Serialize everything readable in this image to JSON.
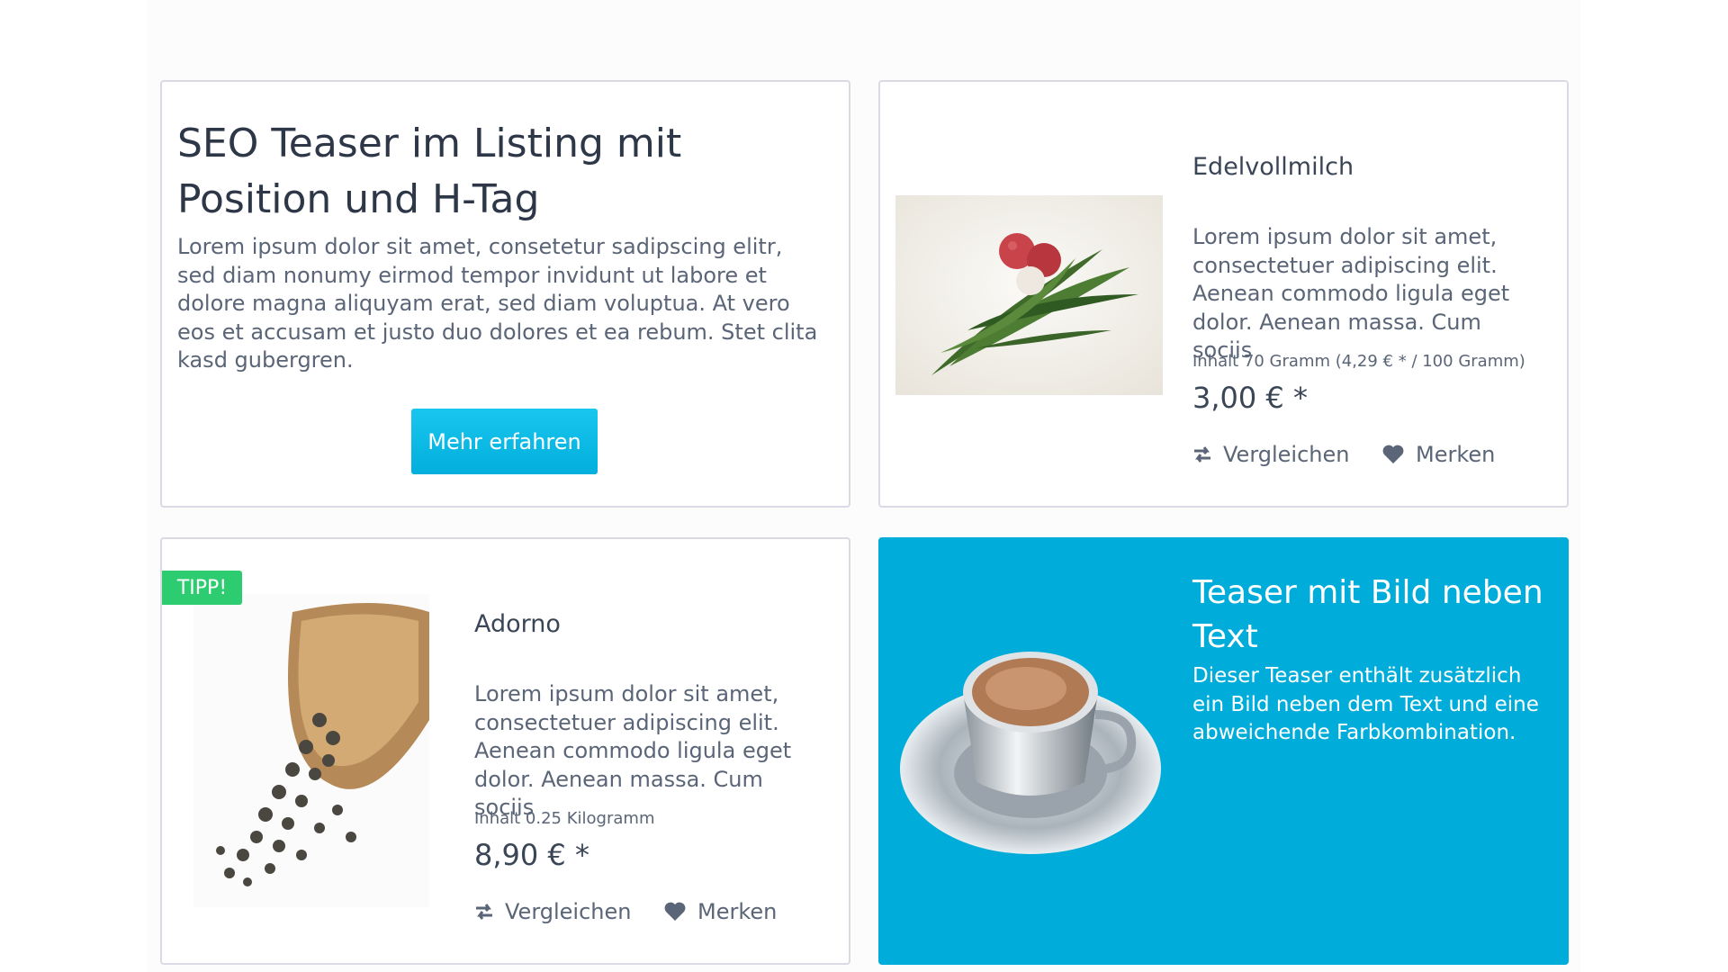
{
  "seo_teaser": {
    "title": "SEO Teaser im Listing mit Position und H-Tag",
    "text": "Lorem ipsum dolor sit amet, consetetur sadipscing elitr, sed diam nonumy eirmod tempor invidunt ut labore et dolore magna aliquyam erat, sed diam voluptua. At vero eos et accusam et justo duo dolores et ea rebum. Stet clita kasd gubergren.",
    "button_label": "Mehr erfahren",
    "accent_color": "#00acd9"
  },
  "products": [
    {
      "name": "Edelvollmilch",
      "description": "Lorem ipsum dolor sit amet, consectetuer adipiscing elit. Aenean commodo ligula eget dolor. Aenean massa. Cum sociis",
      "unit_info": "Inhalt 70 Gramm (4,29 € * / 100 Gramm)",
      "price": "3,00 € *",
      "image_icon": "lychee-image",
      "compare_label": "Vergleichen",
      "wishlist_label": "Merken"
    },
    {
      "name": "Adorno",
      "description": "Lorem ipsum dolor sit amet, consectetuer adipiscing elit. Aenean commodo ligula eget dolor. Aenean massa. Cum sociis",
      "unit_info": "Inhalt 0.25 Kilogramm",
      "price": "8,90 € *",
      "badge": "TIPP!",
      "badge_color": "#2ecc71",
      "image_icon": "pepper-scoop-image",
      "compare_label": "Vergleichen",
      "wishlist_label": "Merken"
    }
  ],
  "image_teaser": {
    "title": "Teaser mit Bild neben Text",
    "text": "Dieser Teaser enthält zusätzlich ein Bild neben dem Text und eine abweichende Farbkombination.",
    "background_color": "#00acd9",
    "image_icon": "coffee-cup-image"
  }
}
